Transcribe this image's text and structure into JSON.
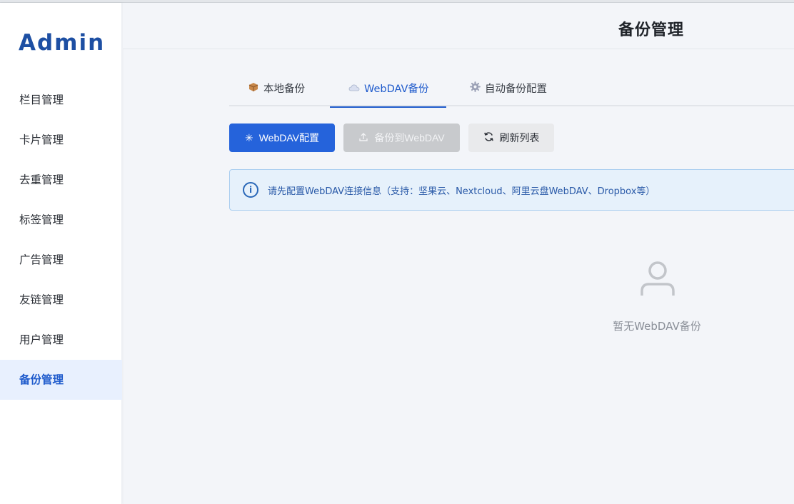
{
  "sidebar": {
    "logo": "Admin",
    "items": [
      {
        "label": "栏目管理"
      },
      {
        "label": "卡片管理"
      },
      {
        "label": "去重管理"
      },
      {
        "label": "标签管理"
      },
      {
        "label": "广告管理"
      },
      {
        "label": "友链管理"
      },
      {
        "label": "用户管理"
      },
      {
        "label": "备份管理",
        "active": true
      }
    ]
  },
  "header": {
    "title": "备份管理"
  },
  "tabs": [
    {
      "label": "本地备份",
      "icon": "package-icon"
    },
    {
      "label": "WebDAV备份",
      "icon": "cloud-icon",
      "active": true
    },
    {
      "label": "自动备份配置",
      "icon": "gear-icon"
    }
  ],
  "toolbar": {
    "config_label": "WebDAV配置",
    "backup_label": "备份到WebDAV",
    "refresh_label": "刷新列表"
  },
  "alert": {
    "text": "请先配置WebDAV连接信息（支持：坚果云、Nextcloud、阿里云盘WebDAV、Dropbox等）"
  },
  "empty": {
    "text": "暂无WebDAV备份"
  },
  "colors": {
    "accent": "#2563db",
    "brand": "#1d4fa3",
    "disabled": "#c8cacd",
    "alert_bg": "#e6f1fb",
    "alert_border": "#a9cdef"
  }
}
